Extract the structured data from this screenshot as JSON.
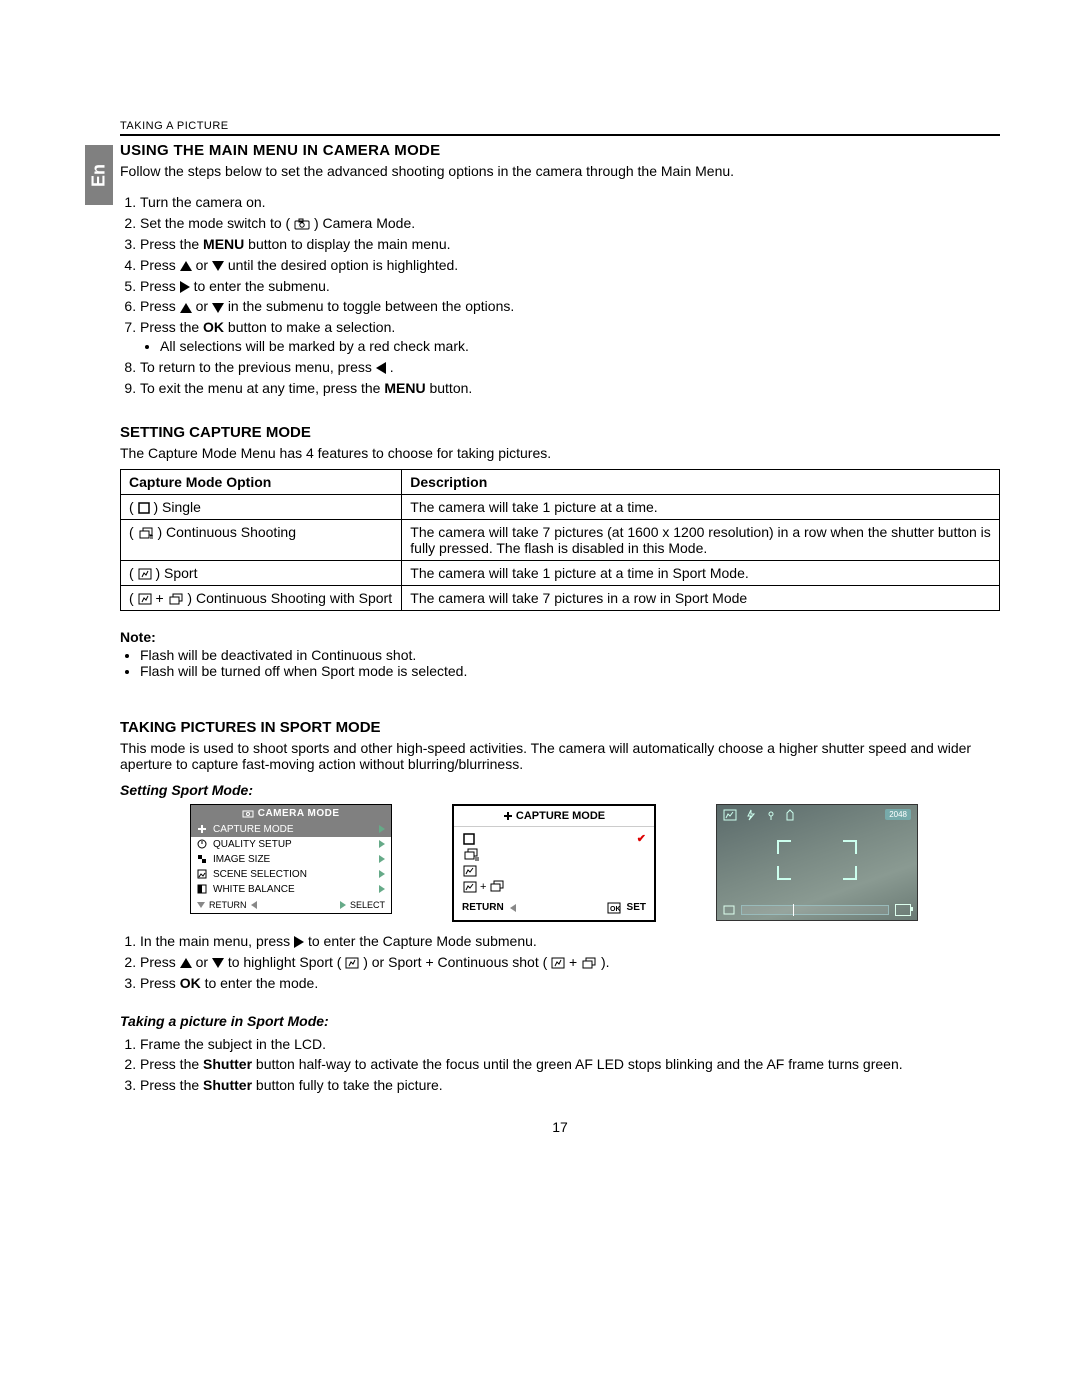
{
  "sideTab": "En",
  "topLabel": "TAKING A PICTURE",
  "section1": {
    "title": "USING THE MAIN MENU IN CAMERA MODE",
    "intro": "Follow the steps below to set the advanced shooting options in the camera through the Main Menu.",
    "steps": {
      "s1": "Turn the camera on.",
      "s2a": "Set the mode switch to (",
      "s2b": ") Camera Mode.",
      "s3a": "Press the ",
      "s3b": "MENU",
      "s3c": " button to display the main menu.",
      "s4a": "Press ",
      "s4b": " or ",
      "s4c": " until the desired option is highlighted.",
      "s5a": "Press ",
      "s5b": " to enter the submenu.",
      "s6a": "Press ",
      "s6b": " or ",
      "s6c": " in the submenu to toggle between the options.",
      "s7a": "Press the ",
      "s7b": "OK",
      "s7c": " button to make a selection.",
      "s7sub": "All selections will be marked by a red check mark.",
      "s8a": "To return to the previous menu, press ",
      "s8b": " .",
      "s9a": "To exit the menu at any time, press the ",
      "s9b": "MENU",
      "s9c": " button."
    }
  },
  "section2": {
    "title": "SETTING CAPTURE MODE",
    "intro": "The Capture Mode Menu has 4 features to choose for taking pictures.",
    "headers": {
      "opt": "Capture Mode Option",
      "desc": "Description"
    },
    "rows": {
      "r1opt": "Single",
      "r1desc": "The camera will take 1 picture at a time.",
      "r2opt": "Continuous Shooting",
      "r2desc": "The camera will take 7 pictures (at 1600 x 1200 resolution) in a row when the shutter button is fully pressed. The flash is disabled in this Mode.",
      "r3opt": "Sport",
      "r3desc": "The camera will take 1 picture at a time in Sport Mode.",
      "r4opt": "Continuous Shooting with Sport",
      "r4desc": "The camera will take 7 pictures in a row in Sport Mode"
    },
    "noteTitle": "Note:",
    "notes": {
      "n1": "Flash will be deactivated in Continuous shot.",
      "n2": "Flash will be turned off when Sport mode is selected."
    }
  },
  "section3": {
    "title": "TAKING PICTURES IN SPORT MODE",
    "intro": "This mode is used to shoot sports and other high-speed activities. The camera will automatically choose a higher shutter speed and wider aperture to capture fast-moving action without blurring/blurriness.",
    "settingHead": "Setting Sport Mode:",
    "menu1": {
      "header": "CAMERA MODE",
      "items": {
        "i1": "CAPTURE MODE",
        "i2": "QUALITY SETUP",
        "i3": "IMAGE SIZE",
        "i4": "SCENE SELECTION",
        "i5": "WHITE BALANCE"
      },
      "footer": {
        "return": "RETURN",
        "select": "SELECT"
      }
    },
    "menu2": {
      "header": "CAPTURE MODE",
      "footer": {
        "return": "RETURN",
        "set": "SET"
      }
    },
    "steps": {
      "s1a": "In the main menu, press ",
      "s1b": " to enter the Capture Mode submenu.",
      "s2a": "Press ",
      "s2b": " or ",
      "s2c": " to highlight Sport ( ",
      "s2d": " ) or Sport + Continuous shot ( ",
      "s2e": " ).",
      "s3a": "Press ",
      "s3b": "OK",
      "s3c": " to enter the mode."
    },
    "takingHead": "Taking a picture in Sport Mode:",
    "tsteps": {
      "t1": "Frame the subject in the LCD.",
      "t2a": "Press the ",
      "t2b": "Shutter",
      "t2c": " button half-way to activate the focus until the green AF LED stops blinking and the AF frame turns green.",
      "t3a": "Press the ",
      "t3b": "Shutter",
      "t3c": " button fully to take the picture."
    }
  },
  "pageNumber": "17"
}
